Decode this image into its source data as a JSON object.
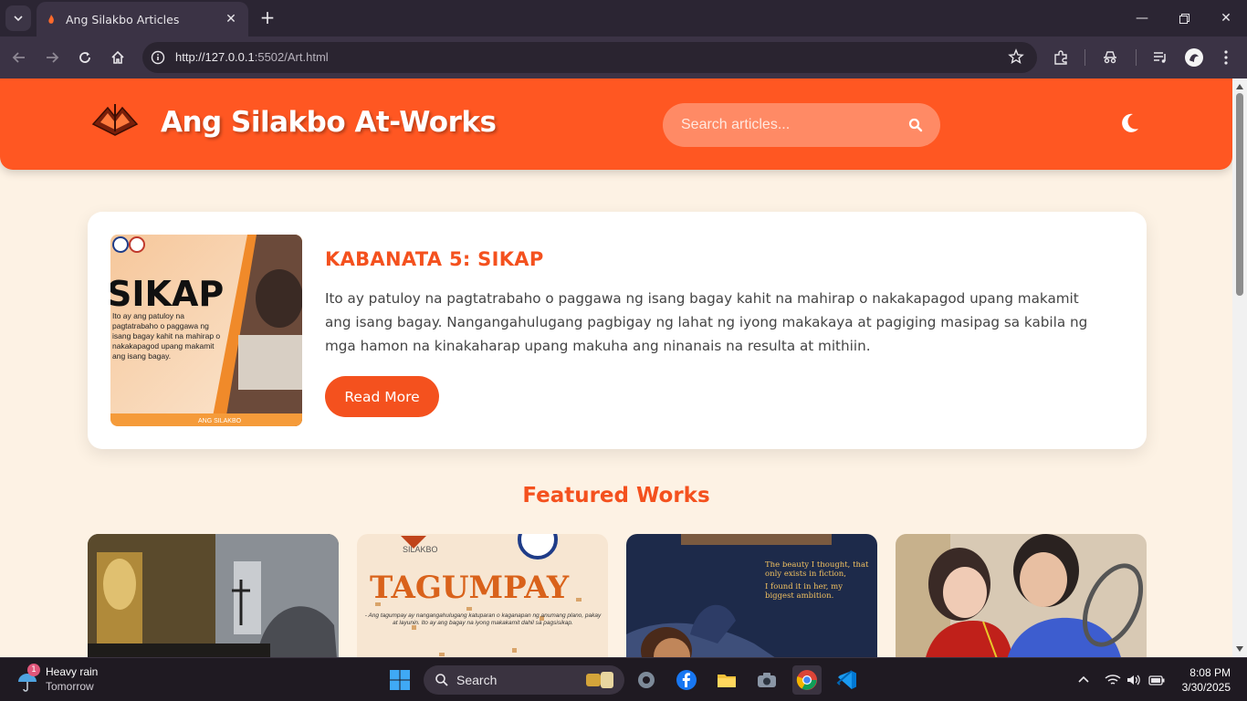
{
  "browser": {
    "tab_title": "Ang Silakbo Articles",
    "url_host": "http://127.0.0.1",
    "url_rest": ":5502/Art.html"
  },
  "site": {
    "title": "Ang Silakbo At-Works",
    "search_placeholder": "Search articles..."
  },
  "article": {
    "title": "KABANATA 5: SIKAP",
    "excerpt": "Ito ay patuloy na pagtatrabaho o paggawa ng isang bagay kahit na mahirap o nakakapagod upang makamit ang isang bagay. Nangangahulugang pagbigay ng lahat ng iyong makakaya at pagiging masipag sa kabila ng mga hamon na kinakaharap upang makuha ang ninanais na resulta at mithiin.",
    "read_more_label": "Read More",
    "thumb": {
      "headline": "SIKAP",
      "body": "Ito ay ang patuloy na pagtatrabaho o paggawa ng isang bagay kahit na mahirap o nakakapagod upang makamit ang isang bagay.",
      "footer": "ANG SILAKBO"
    }
  },
  "featured": {
    "heading": "Featured Works",
    "cards": [
      {
        "label": ""
      },
      {
        "label": "TAGUMPAY",
        "top_text": "SILAKBO",
        "caption": "- Ang tagumpay ay nangangahulugang katuparan o kaganapan ng anumang plano, pakay at layunin. Ito ay ang bagay na iyong makakamit dahil sa pagsisikap."
      },
      {
        "label": "",
        "quote_1": "The beauty I thought, that only exists in fiction,",
        "quote_2": "I found it in her, my biggest ambition."
      },
      {
        "label": ""
      }
    ]
  },
  "taskbar": {
    "weather_title": "Heavy rain",
    "weather_sub": "Tomorrow",
    "weather_badge": "1",
    "search_label": "Search",
    "time": "8:08 PM",
    "date": "3/30/2025"
  },
  "colors": {
    "brand_orange": "#ff5722",
    "accent": "#f4511e",
    "page_bg": "#fdf2e4"
  }
}
